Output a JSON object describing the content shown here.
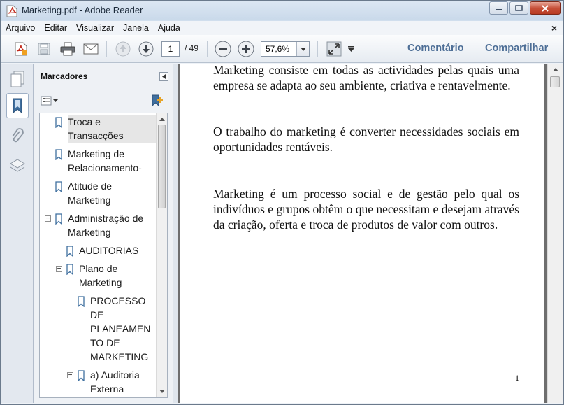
{
  "window": {
    "title": "Marketing.pdf - Adobe Reader"
  },
  "menu": {
    "items": [
      "Arquivo",
      "Editar",
      "Visualizar",
      "Janela",
      "Ajuda"
    ],
    "close_glyph": "×"
  },
  "toolbar": {
    "page_current": "1",
    "page_total": "/ 49",
    "zoom": "57,6%",
    "comment_label": "Comentário",
    "share_label": "Compartilhar"
  },
  "panel": {
    "title": "Marcadores"
  },
  "bookmarks": [
    {
      "label": "Troca e\nTransacções",
      "expander": "",
      "selected": true
    },
    {
      "label": "Marketing de\nRelacionamento-",
      "expander": ""
    },
    {
      "label": "Atitude de\nMarketing",
      "expander": ""
    },
    {
      "label": "Administração de\nMarketing",
      "expander": "−"
    },
    {
      "label": "AUDITORIAS",
      "expander": ""
    },
    {
      "label": "Plano de\nMarketing",
      "expander": "−"
    },
    {
      "label": "PROCESSO\nDE\nPLANEAMEN\nTO DE\nMARKETING",
      "expander": ""
    },
    {
      "label": "a) Auditoria\nExterna",
      "expander": "−"
    }
  ],
  "document": {
    "paragraphs": [
      "Marketing consiste em todas as actividades pelas quais uma empresa se adapta ao seu ambiente, criativa e rentavelmente.",
      "O trabalho do marketing é converter necessidades sociais em oportunidades rentáveis.",
      "Marketing é um processo social e de gestão pelo qual os indivíduos e grupos obtêm o que necessitam e desejam através da criação, oferta e troca de produtos de valor com outros."
    ],
    "page_number": "1"
  },
  "colors": {
    "accent_link": "#4d6e96",
    "close_button": "#c7513a",
    "pdf_red": "#c0281b"
  }
}
